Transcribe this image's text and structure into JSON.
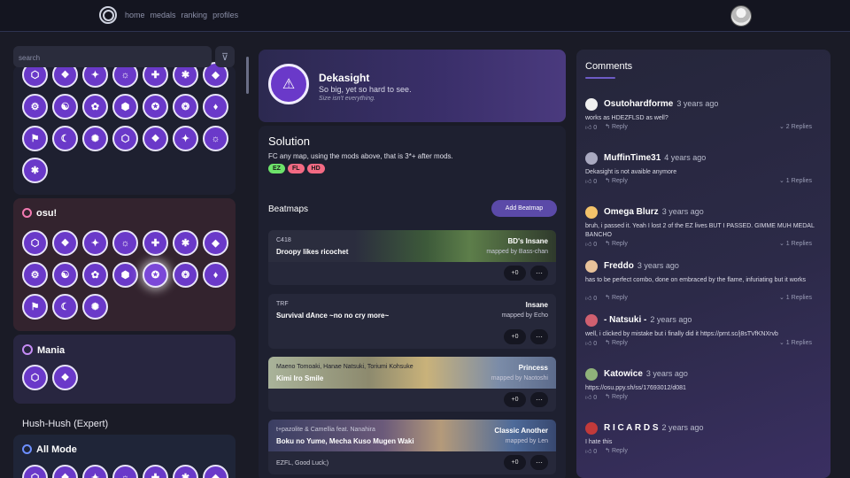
{
  "nav": {
    "items": [
      "home",
      "medals",
      "ranking",
      "profiles"
    ]
  },
  "search": {
    "placeholder": "search"
  },
  "panels": {
    "osu": {
      "title": "osu!",
      "color": "#f27ab1"
    },
    "mania": {
      "title": "Mania",
      "color": "#c58cf5"
    },
    "section": "Hush-Hush (Expert)",
    "allmode": {
      "title": "All Mode",
      "color": "#6d8fff"
    }
  },
  "medal": {
    "name": "Dekasight",
    "description": "So big, yet so hard to see.",
    "note": "Size isn't everything."
  },
  "solution": {
    "title": "Solution",
    "text": "FC any map, using the mods above, that is 3*+ after mods.",
    "mods": [
      {
        "label": "EZ",
        "color": "#6de36a"
      },
      {
        "label": "FL",
        "color": "#f36a83"
      },
      {
        "label": "HD",
        "color": "#f36a83"
      }
    ]
  },
  "beatmaps": {
    "title": "Beatmaps",
    "add_label": "Add Beatmap",
    "rows": [
      {
        "artist": "C418",
        "song": "Droopy likes ricochet",
        "difficulty": "BD's Insane",
        "mapper": "mapped by Bass-chan",
        "votes": "+0",
        "comment": ""
      },
      {
        "artist": "TRF",
        "song": "Survival dAnce ~no no cry more~",
        "difficulty": "Insane",
        "mapper": "mapped by Echo",
        "votes": "+0",
        "comment": ""
      },
      {
        "artist": "Maeno Tomoaki, Hanae Natsuki, Toriumi Kohsuke",
        "song": "Kimi Iro Smile",
        "difficulty": "Princess",
        "mapper": "mapped by Naotoshi",
        "votes": "+0",
        "comment": ""
      },
      {
        "artist": "t+pazolite & Camellia feat. Nanahira",
        "song": "Boku no Yume, Mecha Kuso Mugen Waki",
        "difficulty": "Classic Another",
        "mapper": "mapped by Len",
        "votes": "+0",
        "comment": "EZFL, Good Luck;)"
      }
    ]
  },
  "comments": {
    "title": "Comments",
    "reply_label": "Reply",
    "items": [
      {
        "user": "Osutohardforme",
        "time": "3 years ago",
        "text": "works as HDEZFLSD as well?",
        "likes": "0",
        "replies": "2 Replies"
      },
      {
        "user": "MuffinTime31",
        "time": "4 years ago",
        "text": "Dekasight is not avaible anymore",
        "likes": "0",
        "replies": "1 Replies"
      },
      {
        "user": "Omega Blurz",
        "time": "3 years ago",
        "text": "bruh, i passed it. Yeah I lost 2 of the EZ lives BUT I PASSED. GIMME MUH MEDAL BANCHO",
        "likes": "0",
        "replies": "1 Replies"
      },
      {
        "user": "Freddo",
        "time": "3 years ago",
        "text": "has to be perfect combo, done on embraced by the flame, infuriating but it works",
        "likes": "0",
        "replies": "1 Replies"
      },
      {
        "user": "- Natsuki -",
        "time": "2 years ago",
        "text": "well, i clicked by mistake but i finally did it https://prnt.sc/j8sTVfKNXrvb",
        "likes": "0",
        "replies": "1 Replies"
      },
      {
        "user": "Katowice",
        "time": "3 years ago",
        "text": "https://osu.ppy.sh/ss/17693012/d081",
        "likes": "0",
        "replies": ""
      },
      {
        "user": "R I C A R D S",
        "time": "2 years ago",
        "text": "I hate this",
        "likes": "0",
        "replies": ""
      }
    ]
  }
}
